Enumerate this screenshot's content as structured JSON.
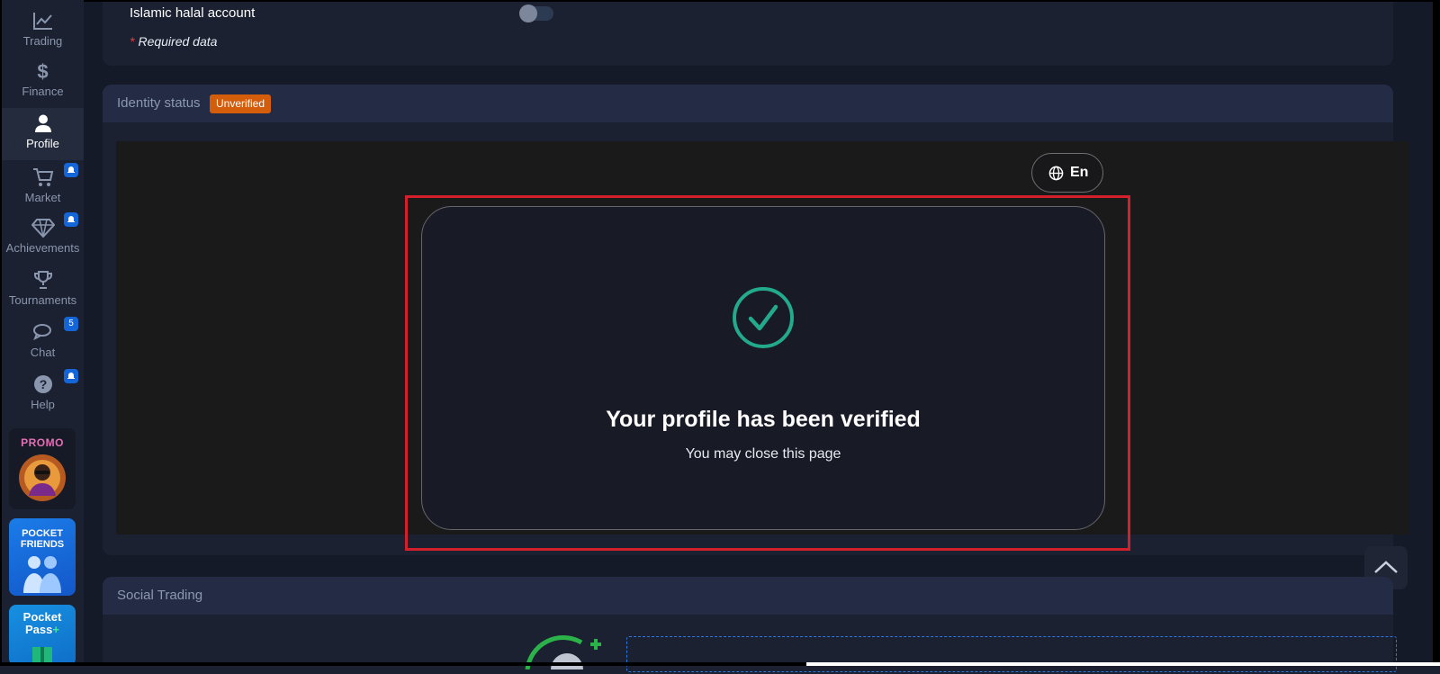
{
  "sidebar": {
    "items": [
      {
        "label": "Trading",
        "icon": "chart-line-icon"
      },
      {
        "label": "Finance",
        "icon": "dollar-icon"
      },
      {
        "label": "Profile",
        "icon": "user-icon"
      },
      {
        "label": "Market",
        "icon": "cart-icon",
        "badge": "bell"
      },
      {
        "label": "Achievements",
        "icon": "diamond-icon",
        "badge": "bell"
      },
      {
        "label": "Tournaments",
        "icon": "trophy-icon"
      },
      {
        "label": "Chat",
        "icon": "chat-icon",
        "badge": "5"
      },
      {
        "label": "Help",
        "icon": "help-icon",
        "badge": "bell"
      }
    ],
    "active": "Profile",
    "promos": [
      {
        "label": "PROMO"
      },
      {
        "label_line1": "POCKET",
        "label_line2": "FRIENDS"
      },
      {
        "label_line1": "Pocket",
        "label_line2": "Pass"
      }
    ]
  },
  "settings": {
    "halal_label": "Islamic halal account",
    "halal_enabled": false,
    "required_star": "*",
    "required_note": "Required data"
  },
  "identity": {
    "title": "Identity status",
    "status_badge": "Unverified",
    "language": "En",
    "verify_title": "Your profile has been verified",
    "verify_subtitle": "You may close this page"
  },
  "social": {
    "title": "Social Trading"
  },
  "colors": {
    "accent_blue": "#1466d8",
    "unverified_orange": "#d45d0c",
    "success_green": "#23a98c",
    "highlight_red": "#d4202a"
  }
}
